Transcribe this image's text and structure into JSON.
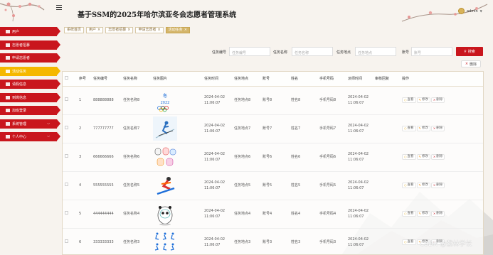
{
  "header": {
    "title": "基于SSM的2025年哈尔滨亚冬会志愿者管理系统",
    "user_name": "admin",
    "user_caret": "▼"
  },
  "sidebar": {
    "items": [
      {
        "label": "用户",
        "active": false,
        "has_children": false
      },
      {
        "label": "志愿者招募",
        "active": false,
        "has_children": false
      },
      {
        "label": "申请志愿者",
        "active": false,
        "has_children": false
      },
      {
        "label": "活动任务",
        "active": true,
        "has_children": false
      },
      {
        "label": "请假信息",
        "active": false,
        "has_children": false
      },
      {
        "label": "到岗信息",
        "active": false,
        "has_children": false
      },
      {
        "label": "加班登录",
        "active": false,
        "has_children": false
      },
      {
        "label": "系统管理",
        "active": false,
        "has_children": true
      },
      {
        "label": "个人中心",
        "active": false,
        "has_children": true
      }
    ]
  },
  "tabs": [
    {
      "label": "系统首页",
      "closable": false,
      "active": false
    },
    {
      "label": "用户",
      "closable": true,
      "active": false
    },
    {
      "label": "志愿者招募",
      "closable": true,
      "active": false
    },
    {
      "label": "申请志愿者",
      "closable": true,
      "active": false
    },
    {
      "label": "活动任务",
      "closable": true,
      "active": true
    }
  ],
  "search": {
    "fields": [
      {
        "label": "任务编号",
        "placeholder": "任务编号"
      },
      {
        "label": "任务名称",
        "placeholder": "任务名称"
      },
      {
        "label": "任务地点",
        "placeholder": "任务地点"
      },
      {
        "label": "账号",
        "placeholder": "账号"
      }
    ],
    "button_label": "搜索",
    "delete_label": "删除"
  },
  "table": {
    "columns": [
      "序号",
      "任务编号",
      "任务名称",
      "任务图片",
      "任务时间",
      "任务地点",
      "账号",
      "姓名",
      "手机号码",
      "派师时间",
      "审核回复",
      "操作"
    ],
    "rows": [
      {
        "no": "1",
        "code": "888888888",
        "name": "任务名称8",
        "image": "beijing-2022-logo",
        "time": "2024-04-02 11:06:07",
        "place": "任务地点8",
        "account": "账号8",
        "person": "姓名8",
        "phone": "手机号码8",
        "dispatch": "2024-04-02 11:06:07",
        "reply": ""
      },
      {
        "no": "2",
        "code": "777777777",
        "name": "任务名称7",
        "image": "skier",
        "time": "2024-04-02 11:06:07",
        "place": "任务地点7",
        "account": "账号7",
        "person": "姓名7",
        "phone": "手机号码7",
        "dispatch": "2024-04-02 11:06:07",
        "reply": ""
      },
      {
        "no": "3",
        "code": "666666666",
        "name": "任务名称6",
        "image": "mascot-group",
        "time": "2024-04-02 11:06:07",
        "place": "任务地点6",
        "account": "账号6",
        "person": "姓名6",
        "phone": "手机号码6",
        "dispatch": "2024-04-02 11:06:07",
        "reply": ""
      },
      {
        "no": "4",
        "code": "555555555",
        "name": "任务名称5",
        "image": "snowboarder",
        "time": "2024-04-02 11:06:07",
        "place": "任务地点5",
        "account": "账号5",
        "person": "姓名5",
        "phone": "手机号码5",
        "dispatch": "2024-04-02 11:06:07",
        "reply": ""
      },
      {
        "no": "5",
        "code": "444444444",
        "name": "任务名称4",
        "image": "panda-mascot",
        "time": "2024-04-02 11:06:07",
        "place": "任务地点4",
        "account": "账号4",
        "person": "姓名4",
        "phone": "手机号码4",
        "dispatch": "2024-04-02 11:06:07",
        "reply": ""
      },
      {
        "no": "6",
        "code": "333333333",
        "name": "任务名称3",
        "image": "sport-pictograms",
        "time": "2024-04-02 11:06:07",
        "place": "任务地点3",
        "account": "账号3",
        "person": "姓名3",
        "phone": "手机号码3",
        "dispatch": "2024-04-02 11:06:07",
        "reply": ""
      }
    ],
    "actions": {
      "view": "查看",
      "edit": "修改",
      "delete": "删除"
    }
  },
  "watermark": "CSDN @紫林学长",
  "colors": {
    "primary": "#c9161d",
    "active": "#f5b800",
    "tab_active": "#d4b56a"
  }
}
